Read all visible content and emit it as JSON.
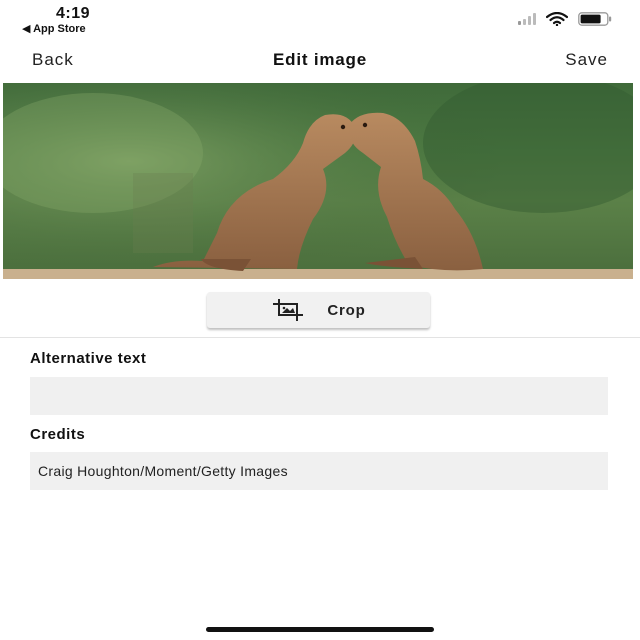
{
  "status_bar": {
    "time": "4:19",
    "back_to_app": "◀ App Store",
    "icons": [
      "signal-icon",
      "wifi-icon",
      "battery-icon"
    ]
  },
  "nav": {
    "back_label": "Back",
    "title": "Edit image",
    "save_label": "Save"
  },
  "image": {
    "subject": "photo-of-two-prairie-dogs"
  },
  "crop": {
    "label": "Crop",
    "icon": "crop-icon"
  },
  "alt_text": {
    "label": "Alternative text",
    "value": ""
  },
  "credits": {
    "label": "Credits",
    "value": "Craig Houghton/Moment/Getty Images"
  }
}
